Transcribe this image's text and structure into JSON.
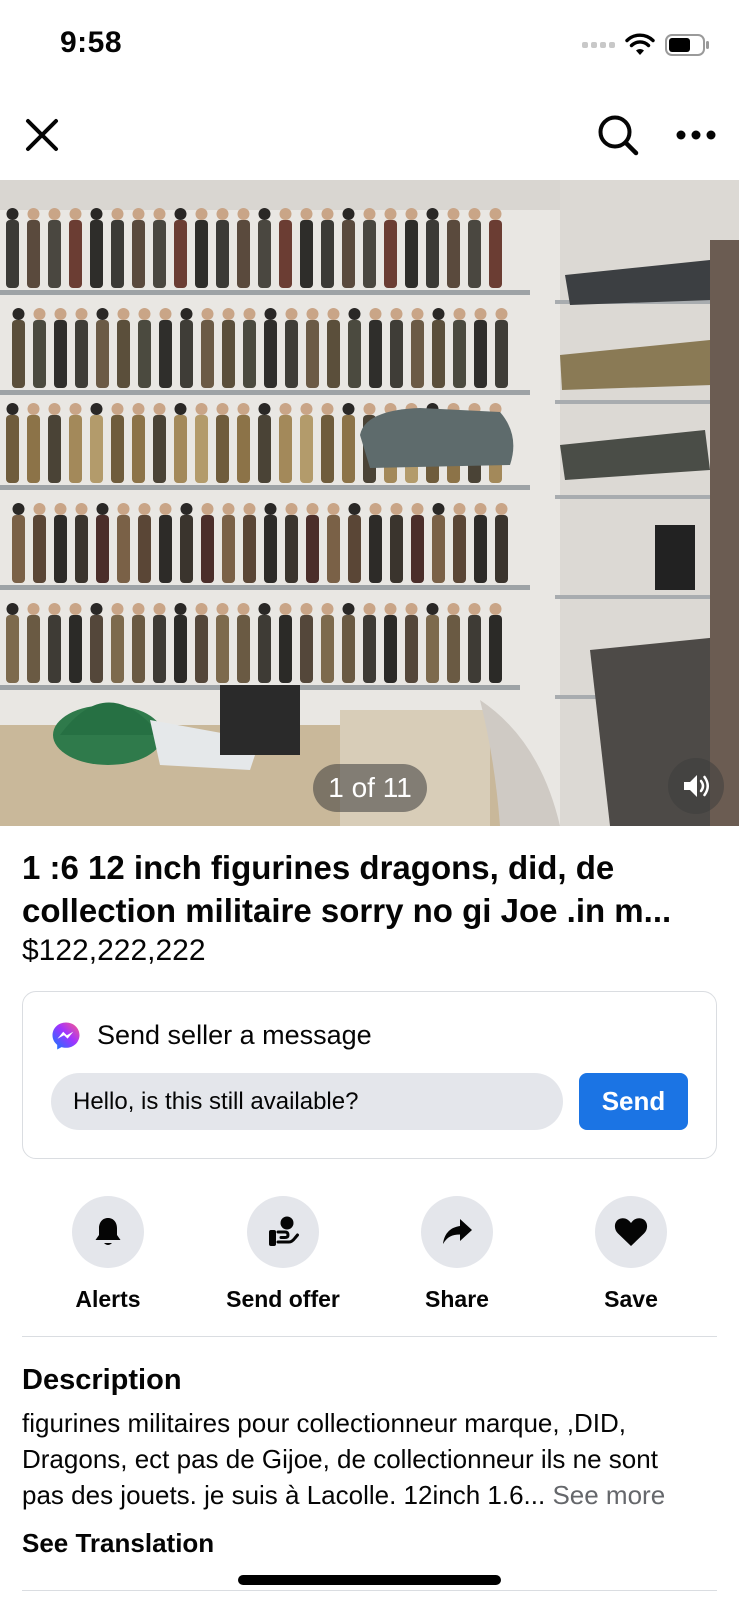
{
  "status_bar": {
    "time": "9:58"
  },
  "listing": {
    "photo_counter": "1 of 11",
    "title_line1": "1 :6   12 inch  figurines dragons, did,  de",
    "title_line2": "collection militaire  sorry no gi Joe .in m...",
    "price": "$122,222,222"
  },
  "message": {
    "heading": "Send seller a message",
    "input_value": "Hello, is this still available?",
    "send_label": "Send"
  },
  "actions": [
    {
      "label": "Alerts",
      "icon": "bell-icon"
    },
    {
      "label": "Send offer",
      "icon": "offer-icon"
    },
    {
      "label": "Share",
      "icon": "share-arrow-icon"
    },
    {
      "label": "Save",
      "icon": "heart-icon"
    }
  ],
  "description": {
    "heading": "Description",
    "line1": "figurines militaires pour collectionneur marque,  ,DID,",
    "line2": "Dragons, ect pas de Gijoe, de collectionneur ils ne sont",
    "line3": "pas des jouets. je suis à Lacolle. 12inch 1.6... ",
    "see_more": "See more",
    "see_translation": "See Translation"
  },
  "colors": {
    "accent": "#1b74e4",
    "secondary_text": "#65676b",
    "chip_bg": "#e4e6eb"
  }
}
